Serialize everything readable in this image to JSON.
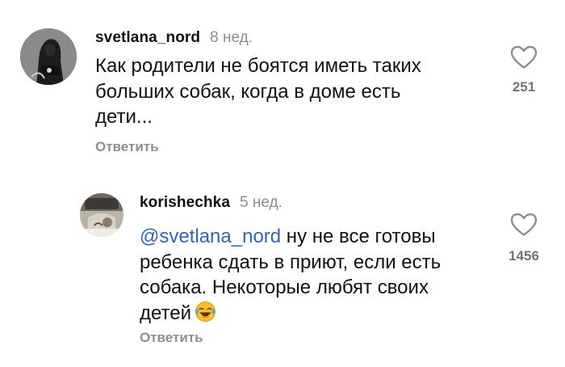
{
  "comments": [
    {
      "username": "svetlana_nord",
      "time": "8 нед.",
      "text": "Как родители не боятся иметь таких больших собак, когда в доме есть дети...",
      "text_lines": [
        "Как родители не боятся иметь таких",
        "больших собак, когда в доме есть",
        "дети..."
      ],
      "reply_label": "Ответить",
      "likes": "251",
      "avatar_icon": "profile-photo-dark"
    },
    {
      "username": "korishechka",
      "time": "5 нед.",
      "mention": "@svetlana_nord",
      "text_lines": [
        " ну не все готовы",
        "ребенка сдать в приют, если есть",
        "собака. Некоторые любят своих",
        "детей"
      ],
      "emoji": "face-with-tears-of-joy",
      "reply_label": "Ответить",
      "likes": "1456",
      "avatar_icon": "profile-photo-car"
    }
  ],
  "colors": {
    "mention": "#3763a8",
    "secondary_text": "#8e8e8e",
    "like_count": "#737373",
    "emoji_yellow": "#f7c02c"
  },
  "icons": {
    "like": "heart-outline-icon"
  }
}
